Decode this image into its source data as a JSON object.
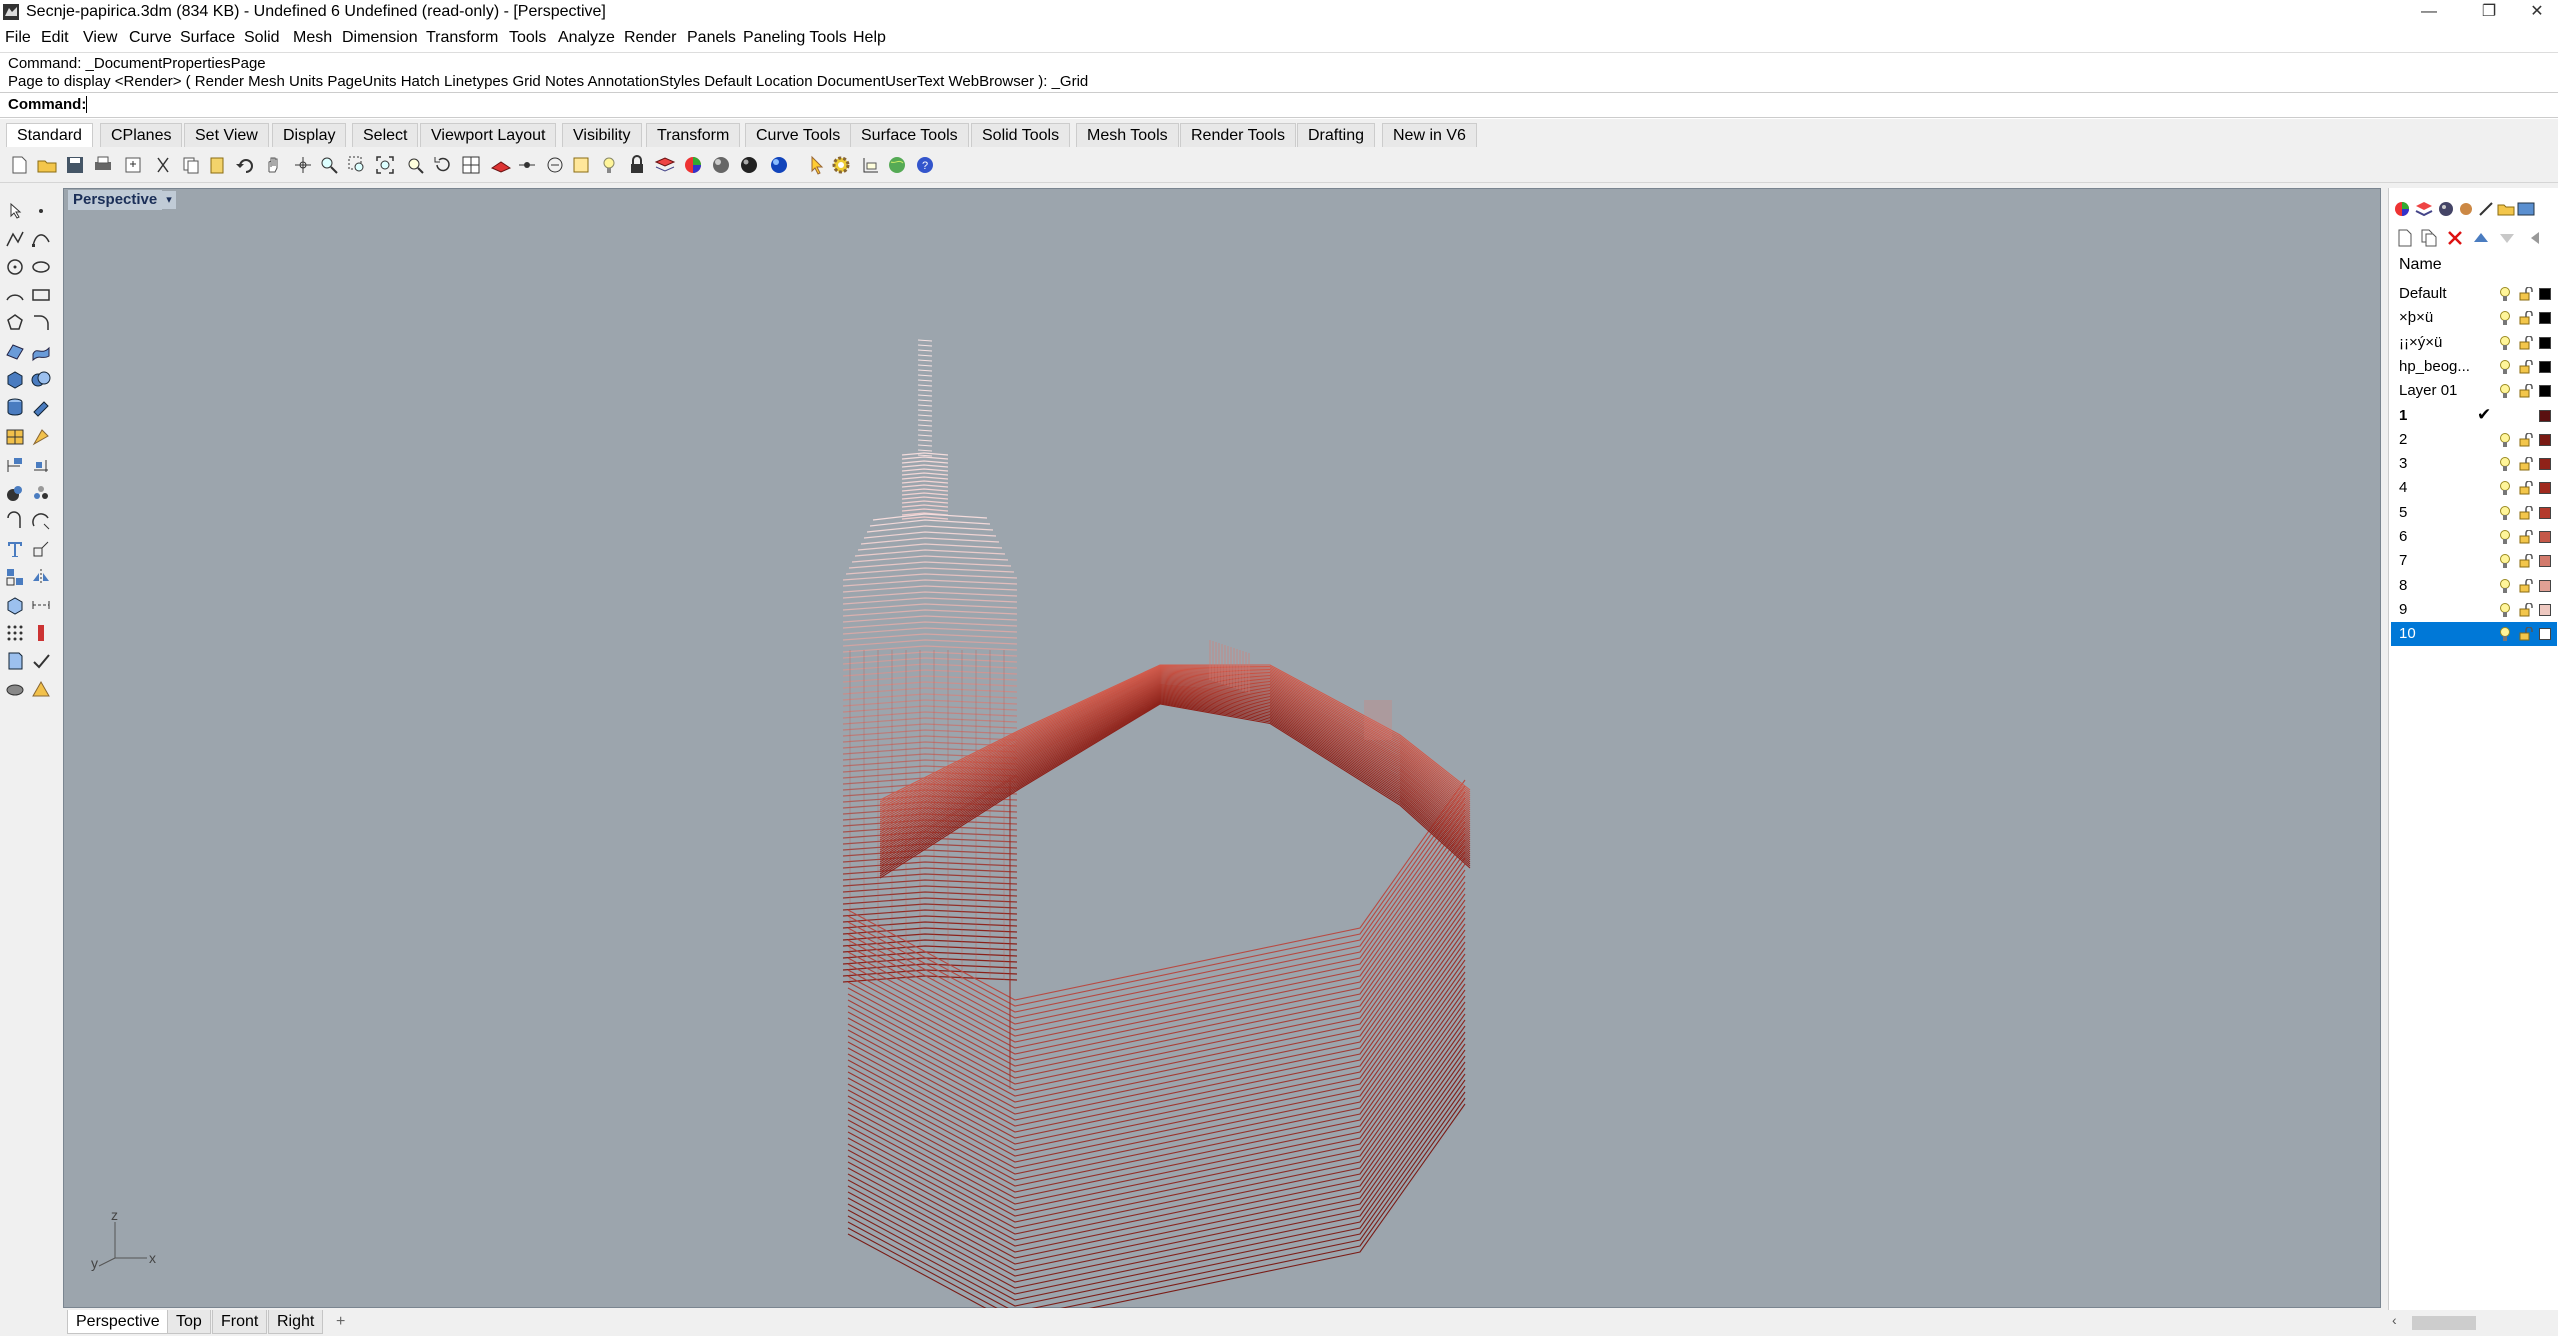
{
  "window": {
    "title": "Secnje-papirica.3dm (834 KB) - Undefined 6 Undefined (read-only) - [Perspective]",
    "controls": [
      "—",
      "❐",
      "✕"
    ]
  },
  "menu": [
    "File",
    "Edit",
    "View",
    "Curve",
    "Surface",
    "Solid",
    "Mesh",
    "Dimension",
    "Transform",
    "Tools",
    "Analyze",
    "Render",
    "Panels",
    "Paneling Tools",
    "Help"
  ],
  "command": {
    "history_1": "Command: _DocumentPropertiesPage",
    "history_2": "Page to display <Render> ( Render  Mesh  Units  PageUnits  Hatch  Linetypes  Grid  Notes  AnnotationStyles  Default  Location  DocumentUserText  WebBrowser ): _Grid",
    "prompt_label": "Command:",
    "input_value": ""
  },
  "toolbar_tabs": [
    "Standard",
    "CPlanes",
    "Set View",
    "Display",
    "Select",
    "Viewport Layout",
    "Visibility",
    "Transform",
    "Curve Tools",
    "Surface Tools",
    "Solid Tools",
    "Mesh Tools",
    "Render Tools",
    "Drafting",
    "New in V6"
  ],
  "active_toolbar_tab": "Standard",
  "viewport": {
    "title": "Perspective",
    "menu_arrow": "▾",
    "axis_labels": {
      "z": "z",
      "y": "y",
      "x": "x"
    },
    "tabs": [
      "Perspective",
      "Top",
      "Front",
      "Right"
    ],
    "add_tab": "+",
    "active_tab": "Perspective"
  },
  "layers_panel": {
    "column_name": "Name",
    "layers": [
      {
        "name": "Default",
        "color": "#000000",
        "current": false
      },
      {
        "name": "×þ×ü",
        "color": "#000000",
        "current": false
      },
      {
        "name": "¡¡×ý×ü",
        "color": "#000000",
        "current": false
      },
      {
        "name": "hp_beog...",
        "color": "#000000",
        "current": false
      },
      {
        "name": "Layer 01",
        "color": "#000000",
        "current": false
      },
      {
        "name": "1",
        "color": "#5a1010",
        "current": true
      },
      {
        "name": "2",
        "color": "#7a1a14",
        "current": false
      },
      {
        "name": "3",
        "color": "#8f2218",
        "current": false
      },
      {
        "name": "4",
        "color": "#a02a1e",
        "current": false
      },
      {
        "name": "5",
        "color": "#b33a2c",
        "current": false
      },
      {
        "name": "6",
        "color": "#c45848",
        "current": false
      },
      {
        "name": "7",
        "color": "#d27a6c",
        "current": false
      },
      {
        "name": "8",
        "color": "#e0a094",
        "current": false
      },
      {
        "name": "9",
        "color": "#eec8c0",
        "current": false
      },
      {
        "name": "10",
        "color": "#ffffff",
        "current": false
      }
    ],
    "selected_layer": "10",
    "current_mark": "✔"
  },
  "colors": {
    "viewport_bg": "#9ca5ad",
    "viewport_title_bg": "#c0cbd6",
    "selection": "#0078d7",
    "model_dark": "#8a1f18",
    "model_light": "#f4dcdc"
  }
}
